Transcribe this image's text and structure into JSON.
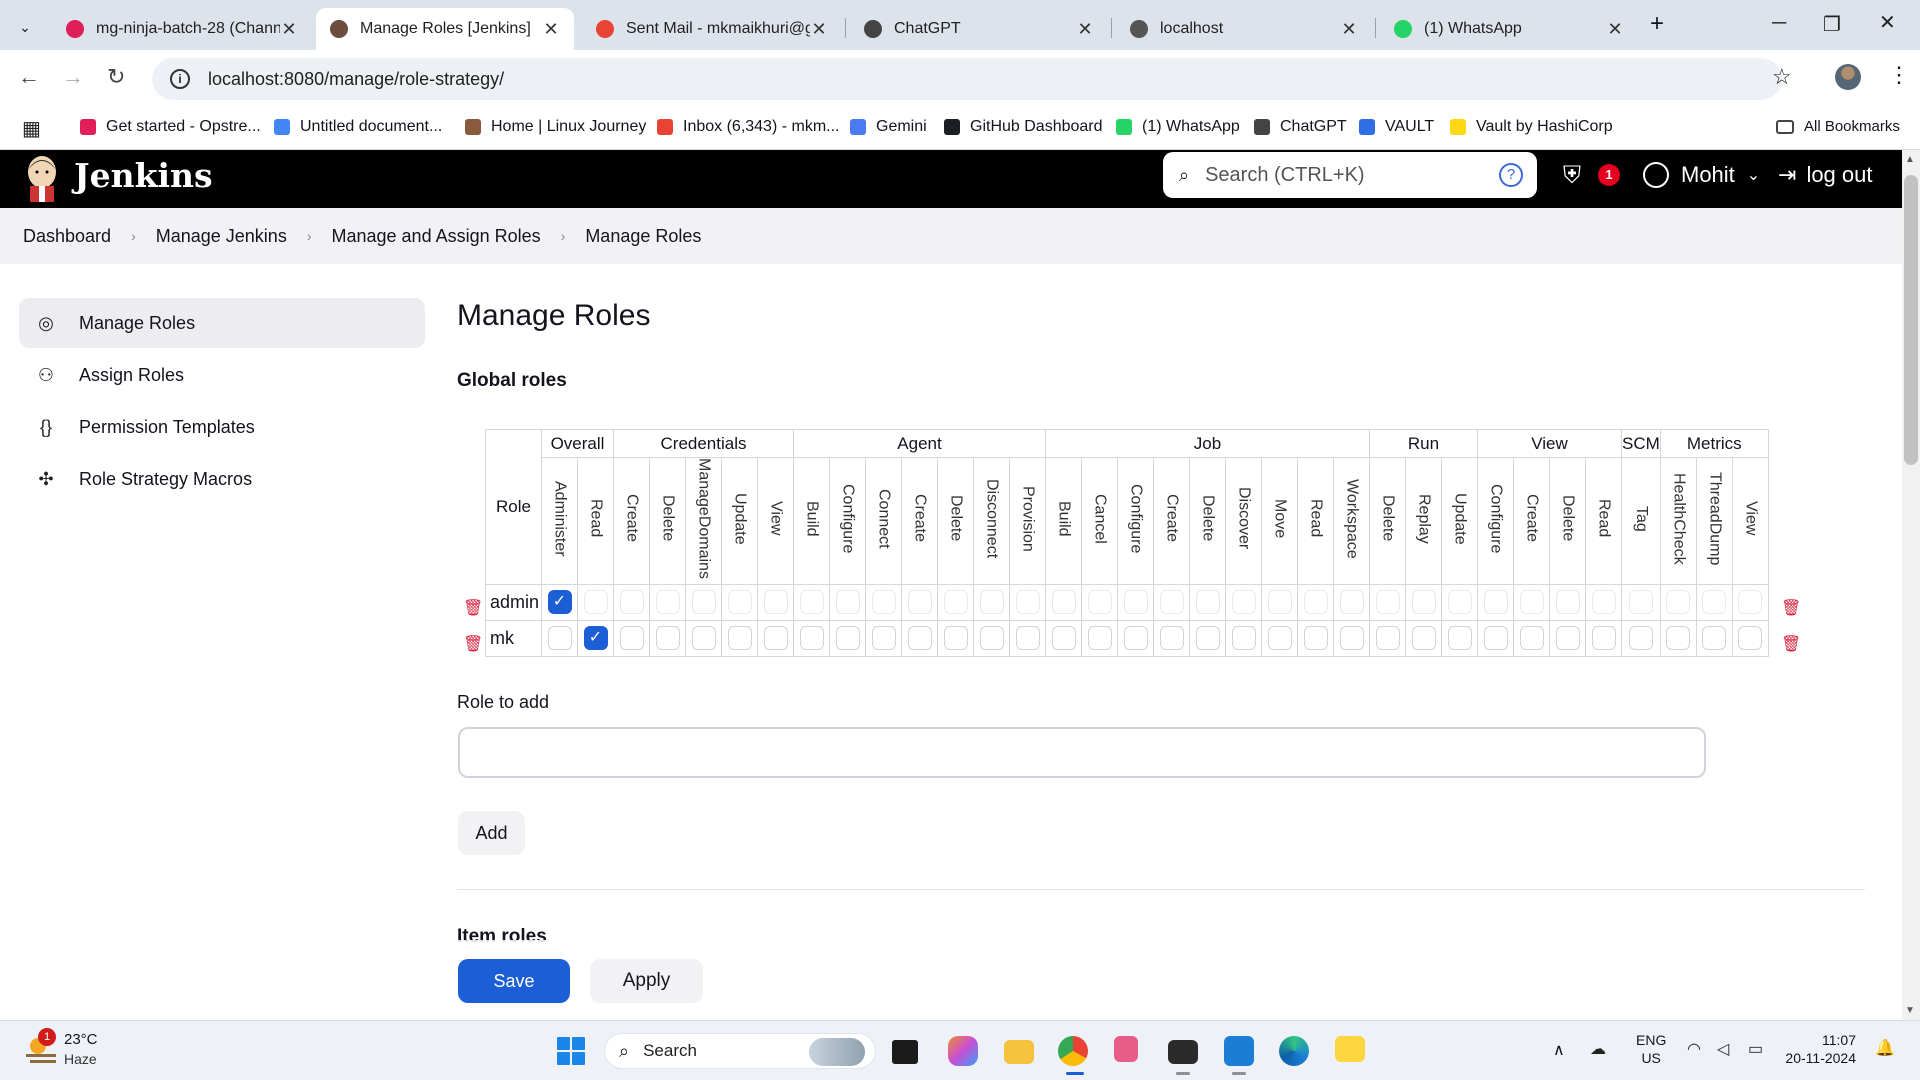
{
  "browser": {
    "tabs": [
      {
        "title": "mg-ninja-batch-28 (Chann",
        "color": "#e01e5a"
      },
      {
        "title": "Manage Roles [Jenkins]",
        "color": "#6b4e3d"
      },
      {
        "title": "Sent Mail - mkmaikhuri@g",
        "color": "#ea4335"
      },
      {
        "title": "ChatGPT",
        "color": "#444444"
      },
      {
        "title": "localhost",
        "color": "#555555"
      },
      {
        "title": "(1) WhatsApp",
        "color": "#25d366"
      }
    ],
    "new_tab": "+",
    "url": "localhost:8080/manage/role-strategy/",
    "bookmarks": [
      {
        "label": "Get started - Opstre...",
        "color": "#e01e5a"
      },
      {
        "label": "Untitled document...",
        "color": "#4285f4"
      },
      {
        "label": "Home | Linux Journey",
        "color": "#8a5a3c"
      },
      {
        "label": "Inbox (6,343) - mkm...",
        "color": "#ea4335"
      },
      {
        "label": "Gemini",
        "color": "#4a7bf0"
      },
      {
        "label": "GitHub Dashboard",
        "color": "#1b1f23"
      },
      {
        "label": "(1) WhatsApp",
        "color": "#25d366"
      },
      {
        "label": "ChatGPT",
        "color": "#444444"
      },
      {
        "label": "VAULT",
        "color": "#2f6fe4"
      },
      {
        "label": "Vault by HashiCorp",
        "color": "#ffd814"
      }
    ],
    "all_bookmarks": "All Bookmarks"
  },
  "jenkins": {
    "title": "Jenkins",
    "search_placeholder": "Search (CTRL+K)",
    "help": "?",
    "alert_count": "1",
    "user": "Mohit",
    "logout": "log out"
  },
  "breadcrumbs": [
    "Dashboard",
    "Manage Jenkins",
    "Manage and Assign Roles",
    "Manage Roles"
  ],
  "sidebar": [
    {
      "label": "Manage Roles",
      "icon": "fingerprint-icon"
    },
    {
      "label": "Assign Roles",
      "icon": "people-icon"
    },
    {
      "label": "Permission Templates",
      "icon": "braces-icon"
    },
    {
      "label": "Role Strategy Macros",
      "icon": "puzzle-icon"
    }
  ],
  "main": {
    "title": "Manage Roles",
    "global_roles": "Global roles",
    "role_header": "Role",
    "groups": [
      {
        "name": "Overall",
        "perms": [
          "Administer",
          "Read"
        ]
      },
      {
        "name": "Credentials",
        "perms": [
          "Create",
          "Delete",
          "ManageDomains",
          "Update",
          "View"
        ]
      },
      {
        "name": "Agent",
        "perms": [
          "Build",
          "Configure",
          "Connect",
          "Create",
          "Delete",
          "Disconnect",
          "Provision"
        ]
      },
      {
        "name": "Job",
        "perms": [
          "Build",
          "Cancel",
          "Configure",
          "Create",
          "Delete",
          "Discover",
          "Move",
          "Read",
          "Workspace"
        ]
      },
      {
        "name": "Run",
        "perms": [
          "Delete",
          "Replay",
          "Update"
        ]
      },
      {
        "name": "View",
        "perms": [
          "Configure",
          "Create",
          "Delete",
          "Read"
        ]
      },
      {
        "name": "SCM",
        "perms": [
          "Tag"
        ]
      },
      {
        "name": "Metrics",
        "perms": [
          "HealthCheck",
          "ThreadDump",
          "View"
        ]
      }
    ],
    "roles": [
      {
        "name": "admin",
        "checked": [
          0
        ],
        "faint_others": true
      },
      {
        "name": "mk",
        "checked": [
          1
        ],
        "faint_others": false
      }
    ],
    "role_to_add_label": "Role to add",
    "role_to_add_value": "",
    "add_button": "Add",
    "item_roles": "Item roles",
    "save_button": "Save",
    "apply_button": "Apply"
  },
  "taskbar": {
    "weather_badge": "1",
    "temperature": "23°C",
    "condition": "Haze",
    "search": "Search",
    "lang_line1": "ENG",
    "lang_line2": "US",
    "time": "11:07",
    "date": "20-11-2024"
  }
}
